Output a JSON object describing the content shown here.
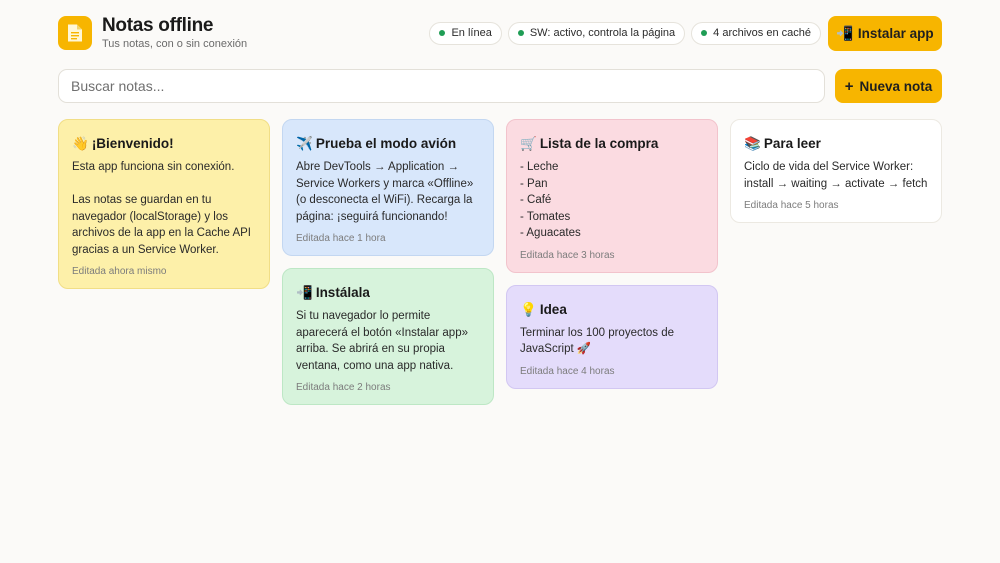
{
  "header": {
    "title": "Notas offline",
    "subtitle": "Tus notas, con o sin conexión",
    "logo_icon": "document-icon",
    "status": [
      {
        "label": "En línea",
        "color": "#1f9d55"
      },
      {
        "label": "SW: activo, controla la página",
        "color": "#1f9d55"
      },
      {
        "label": "4 archivos en caché",
        "color": "#1f9d55"
      }
    ],
    "install_label": "Instalar app",
    "install_emoji": "📲"
  },
  "search": {
    "placeholder": "Buscar notas...",
    "value": ""
  },
  "new_note": {
    "label": "Nueva nota",
    "icon": "+"
  },
  "notes": [
    {
      "emoji": "👋",
      "title": "¡Bienvenido!",
      "color": "yellow",
      "body": "Esta app funciona sin conexión.\n\nLas notas se guardan en tu navegador (localStorage) y los archivos de la app en la Cache API gracias a un Service Worker.",
      "meta": "Editada ahora mismo"
    },
    {
      "emoji": "✈️",
      "title": "Prueba el modo avión",
      "color": "blue",
      "body": "Abre DevTools → Application → Service Workers y marca «Offline» (o desconecta el WiFi). Recarga la página: ¡seguirá funcionando!",
      "meta": "Editada hace 1 hora"
    },
    {
      "emoji": "📲",
      "title": "Instálala",
      "color": "green",
      "body": "Si tu navegador lo permite aparecerá el botón «Instalar app» arriba. Se abrirá en su propia ventana, como una app nativa.",
      "meta": "Editada hace 2 horas"
    },
    {
      "emoji": "🛒",
      "title": "Lista de la compra",
      "color": "pink",
      "body": "- Leche\n- Pan\n- Café\n- Tomates\n- Aguacates",
      "meta": "Editada hace 3 horas"
    },
    {
      "emoji": "💡",
      "title": "Idea",
      "color": "purple",
      "body": "Terminar los 100 proyectos de JavaScript 🚀",
      "meta": "Editada hace 4 horas"
    },
    {
      "emoji": "📚",
      "title": "Para leer",
      "color": "white",
      "body": "Ciclo de vida del Service Worker: install → waiting → activate → fetch",
      "meta": "Editada hace 5 horas"
    }
  ]
}
